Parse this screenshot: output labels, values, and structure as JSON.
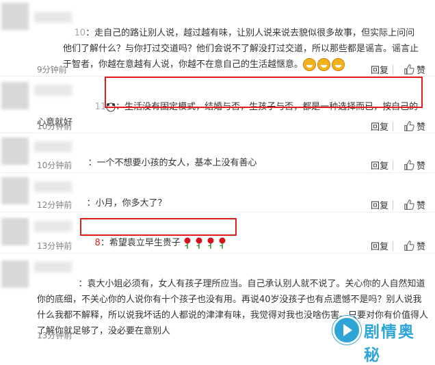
{
  "comments": [
    {
      "uid_suffix": "10",
      "text": "：走自己的路让别人说，越过越有味，让别人说来说去貌似很多故事，但实际上问问他们了解什么？与你打过交道吗？他们会说不了解没打过交道，所以那些都是谣言。谣言止于智者，你越在意越有人说，你越不在意自己的生活越惬意。",
      "emoji_count": 3,
      "time": "9分钟前",
      "reply": "回复",
      "like": "赞"
    },
    {
      "uid_suffix": "11",
      "text": "：生活没有固定模式，结婚与否，生孩子与否，都是一种选择而已，按自己的心意就好",
      "time": "10分钟前",
      "reply": "回复",
      "like": "赞"
    },
    {
      "uid_suffix": "",
      "text": "：一个不想要小孩的女人，基本上没有善心",
      "time": "10分钟前",
      "reply": "回复",
      "like": "赞"
    },
    {
      "uid_suffix": "",
      "text": "：小月，你多大了？",
      "time": "12分钟前",
      "reply": "回复",
      "like": "赞"
    },
    {
      "uid_suffix": "8",
      "text": "：希望袁立早生贵子",
      "rose_count": 4,
      "time": "13分钟前",
      "reply": "回复",
      "like": "赞"
    },
    {
      "uid_suffix": "",
      "text": "：袁大小姐必须有，女人有孩子理所应当。自己承认别人就不说了。关心你的人自然知道你的底细，不关心你的人说你有十个孩子也没有用。再说40岁没孩子也有点遗憾不是吗？别人说我什么我都不解释，所以说我坏话的人都说的津津有味，我觉得对我也没啥伤害。只要对你有价值得人了解你就足够了，没必要在意别人",
      "time": "13分钟前",
      "reply": "回复",
      "like": "赞"
    }
  ],
  "watermark": {
    "text": "剧情奥秘"
  },
  "colors": {
    "highlight": "#e41b1b",
    "muted": "#808080",
    "watermark": "#2fa4d6"
  }
}
